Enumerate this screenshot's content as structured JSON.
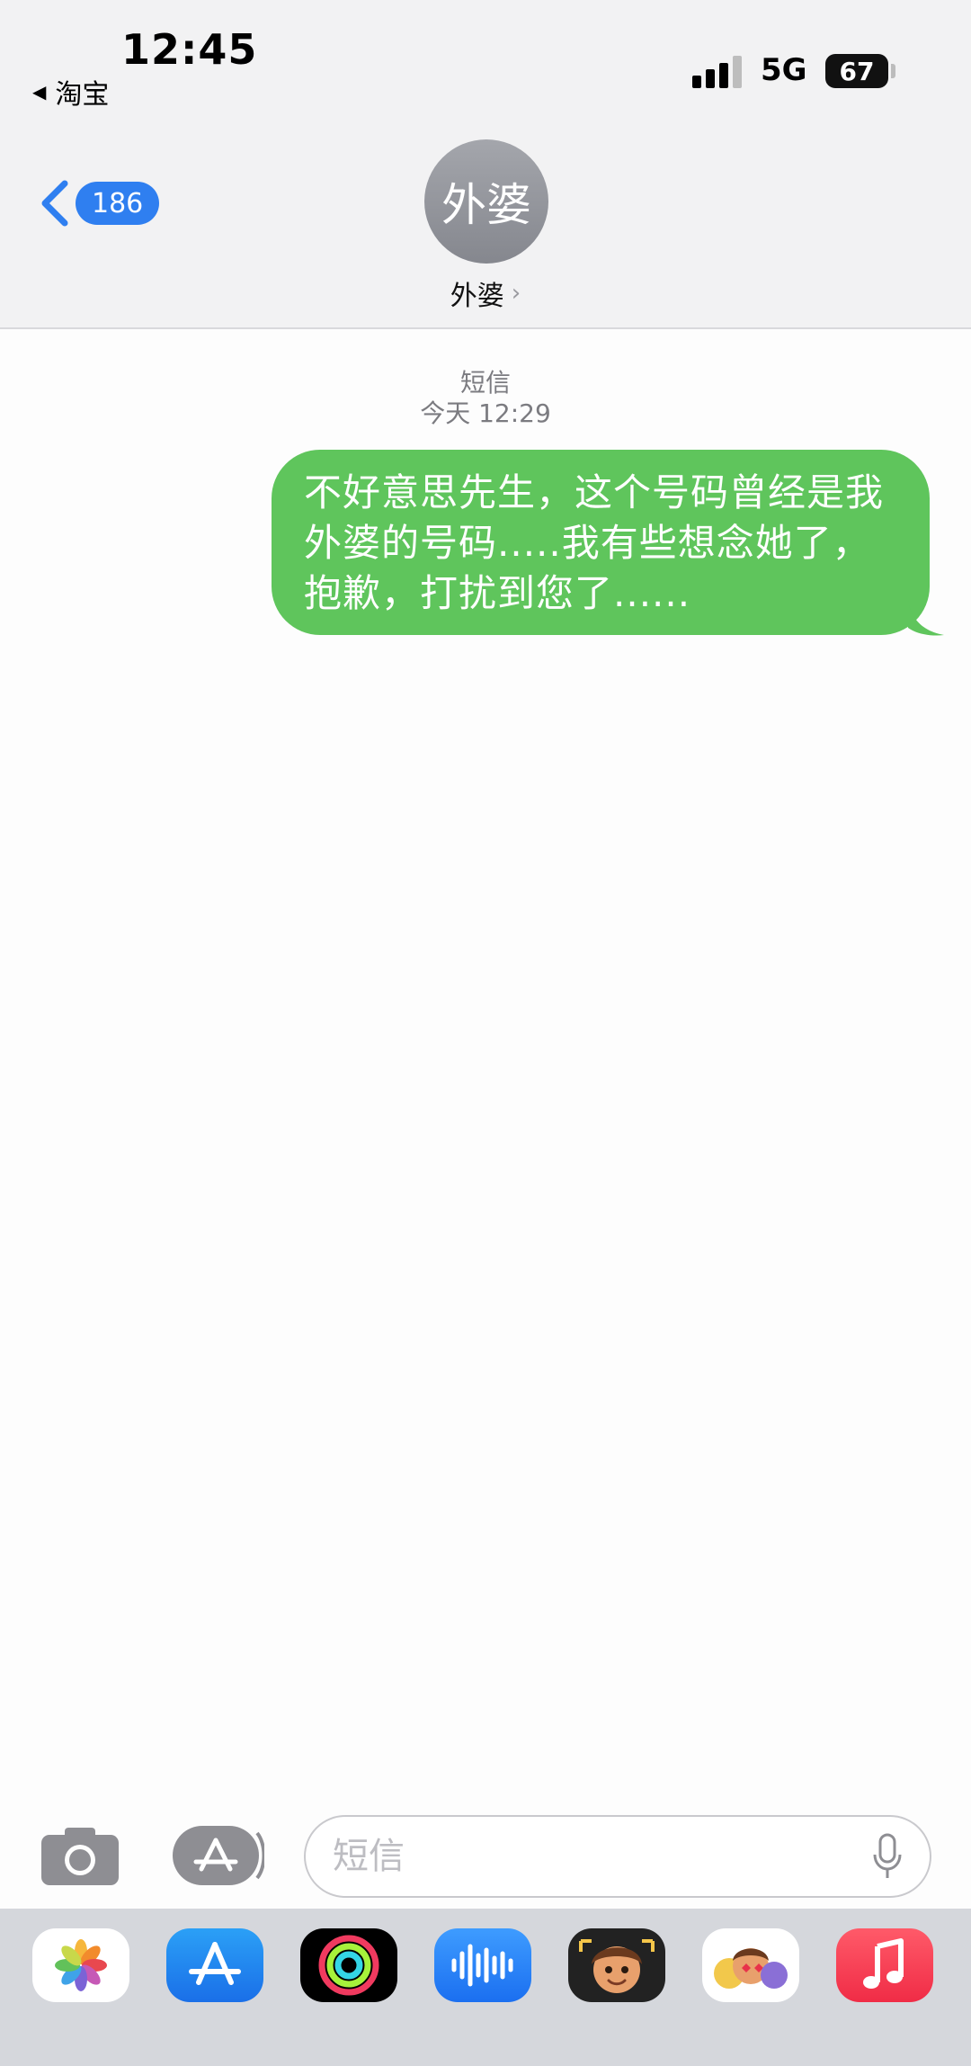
{
  "status_bar": {
    "time": "12:45",
    "back_app": "淘宝",
    "network": "5G",
    "battery": "67"
  },
  "nav": {
    "unread_count": "186",
    "avatar_text": "外婆",
    "contact_name": "外婆"
  },
  "conversation": {
    "service_label": "短信",
    "timestamp": "今天 12:29",
    "messages": [
      {
        "direction": "outgoing",
        "text": "不好意思先生，这个号码曾经是我外婆的号码.....我有些想念她了，抱歉，打扰到您了......"
      }
    ]
  },
  "compose": {
    "placeholder": "短信"
  },
  "app_drawer": {
    "apps": [
      "photos-icon",
      "app-store-icon",
      "fitness-icon",
      "audio-message-icon",
      "memoji-icon",
      "memoji-stickers-icon",
      "music-icon"
    ]
  },
  "colors": {
    "bubble_green": "#5fc55c",
    "badge_blue": "#2f7ff0"
  }
}
